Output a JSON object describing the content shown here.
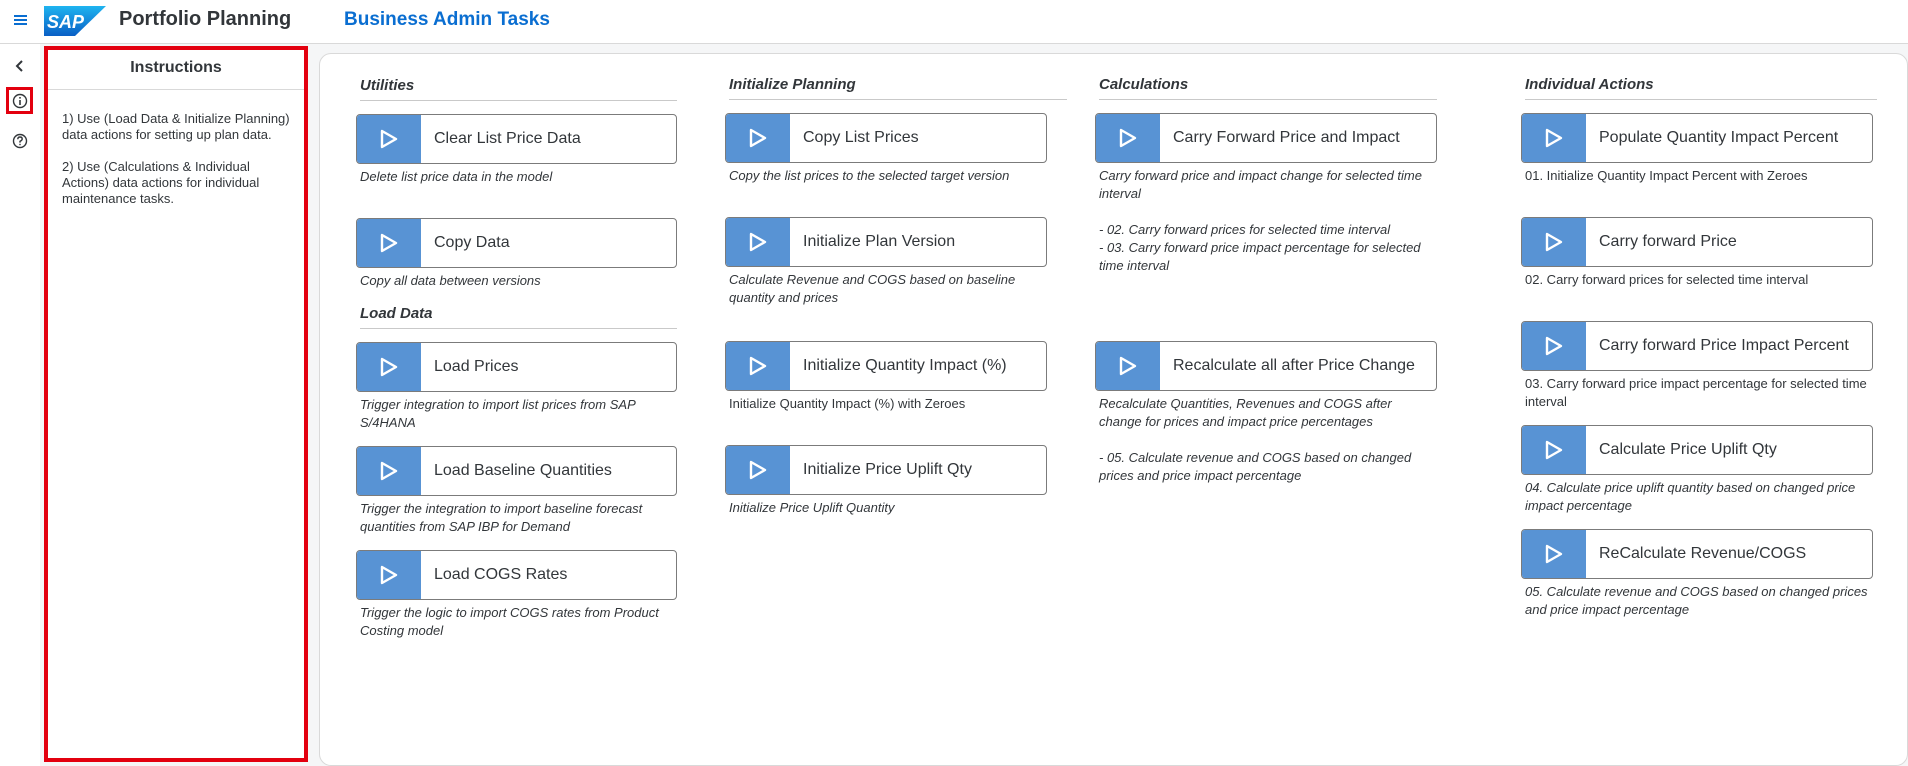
{
  "header": {
    "logo_text": "SAP",
    "app_title": "Portfolio Planning",
    "page_title": "Business Admin Tasks"
  },
  "rail": {
    "icons": [
      "chevron-left-icon",
      "info-icon",
      "help-icon"
    ]
  },
  "instructions": {
    "title": "Instructions",
    "items": [
      "1) Use (Load Data & Initialize Planning) data actions for setting up plan data.",
      "2) Use (Calculations & Individual Actions) data actions for individual maintenance tasks."
    ]
  },
  "sections": {
    "utilities": "Utilities",
    "load_data": "Load Data",
    "initialize_planning": "Initialize Planning",
    "calculations": "Calculations",
    "individual_actions": "Individual Actions"
  },
  "actions": {
    "clear_list_price": {
      "label": "Clear List Price Data",
      "desc": "Delete list price data in the model"
    },
    "copy_data": {
      "label": "Copy Data",
      "desc": "Copy all data between versions"
    },
    "load_prices": {
      "label": "Load Prices",
      "desc": "Trigger integration to import list prices from SAP S/4HANA"
    },
    "load_baseline": {
      "label": "Load Baseline Quantities",
      "desc": "Trigger the integration to import baseline forecast quantities from SAP IBP for Demand"
    },
    "load_cogs": {
      "label": "Load COGS Rates",
      "desc": "Trigger the logic to import COGS rates from Product Costing model"
    },
    "copy_list_prices": {
      "label": "Copy List Prices",
      "desc": "Copy the list prices to the selected target version"
    },
    "init_plan_version": {
      "label": "Initialize Plan Version",
      "desc": "Calculate Revenue and COGS based on baseline quantity and prices"
    },
    "init_qty_impact": {
      "label": "Initialize Quantity Impact (%)",
      "desc": "Initialize Quantity Impact (%) with Zeroes"
    },
    "init_price_uplift": {
      "label": "Initialize Price Uplift Qty",
      "desc": "Initialize Price Uplift Quantity"
    },
    "carry_fwd_price_impact": {
      "label": "Carry Forward Price and Impact",
      "desc": "Carry forward price and impact change for selected time interval",
      "desc2": "- 02. Carry forward prices for selected time interval",
      "desc3": "- 03. Carry forward price impact percentage for selected time interval"
    },
    "recalc_all": {
      "label": "Recalculate all after Price Change",
      "desc": "Recalculate Quantities, Revenues and COGS after change for prices and impact price percentages",
      "desc2": "- 05. Calculate revenue and COGS based on changed prices and price impact percentage"
    },
    "populate_qty_impact": {
      "label": "Populate Quantity Impact Percent",
      "desc": "01. Initialize Quantity Impact Percent with Zeroes"
    },
    "carry_fwd_price": {
      "label": "Carry forward Price",
      "desc": "02. Carry forward prices for selected time interval"
    },
    "carry_fwd_impact_pct": {
      "label": "Carry forward Price Impact Percent",
      "desc": "03. Carry forward price impact percentage for selected time interval"
    },
    "calc_price_uplift": {
      "label": "Calculate Price Uplift Qty",
      "desc": "04. Calculate price uplift quantity based on changed price impact percentage"
    },
    "recalc_revenue": {
      "label": "ReCalculate Revenue/COGS",
      "desc": "05. Calculate revenue and COGS based on changed prices and price impact percentage"
    }
  },
  "colors": {
    "accent": "#0a6ed1",
    "play_button": "#5893d4",
    "highlight": "#e3000f"
  }
}
